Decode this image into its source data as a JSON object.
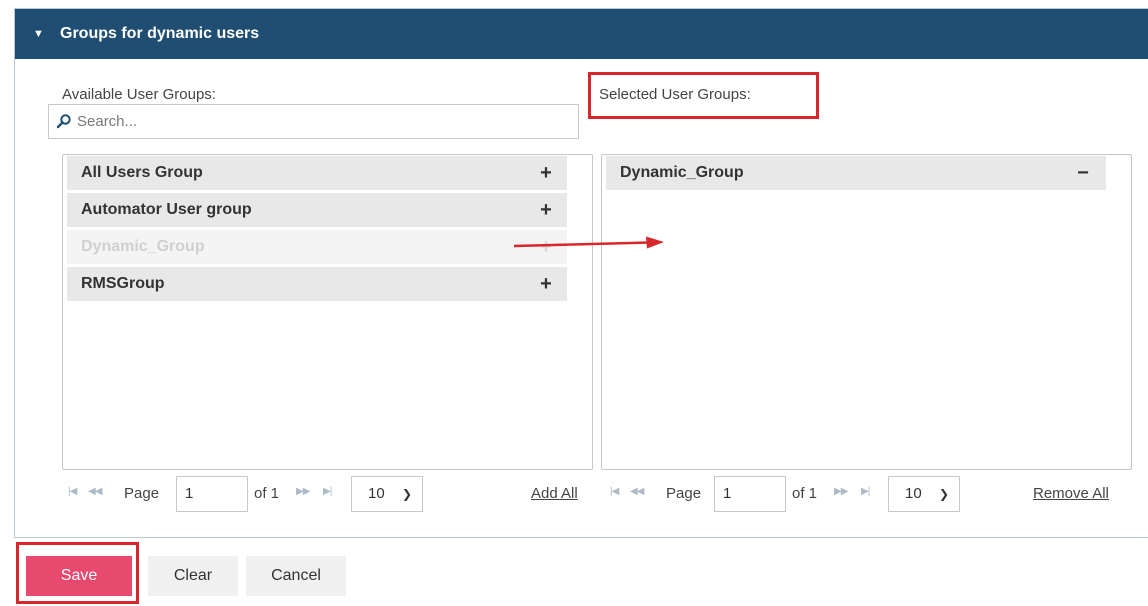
{
  "section": {
    "title": "Groups for dynamic users"
  },
  "available": {
    "label": "Available User Groups:",
    "search_placeholder": "Search...",
    "items": [
      {
        "name": "All Users Group",
        "action": "+"
      },
      {
        "name": "Automator User group",
        "action": "+"
      },
      {
        "name": "Dynamic_Group",
        "action": "+"
      },
      {
        "name": "RMSGroup",
        "action": "+"
      }
    ],
    "pager": {
      "page_label": "Page",
      "page": "1",
      "of_label": "of 1",
      "page_size": "10",
      "bulk_action": "Add All"
    }
  },
  "selected": {
    "label": "Selected User Groups:",
    "items": [
      {
        "name": "Dynamic_Group",
        "action": "−"
      }
    ],
    "pager": {
      "page_label": "Page",
      "page": "1",
      "of_label": "of 1",
      "page_size": "10",
      "bulk_action": "Remove All"
    }
  },
  "buttons": {
    "save": "Save",
    "clear": "Clear",
    "cancel": "Cancel"
  },
  "colors": {
    "header": "#1f4e72",
    "save": "#e84a6f",
    "highlight": "#d7262c",
    "arrow": "#d7262c"
  }
}
